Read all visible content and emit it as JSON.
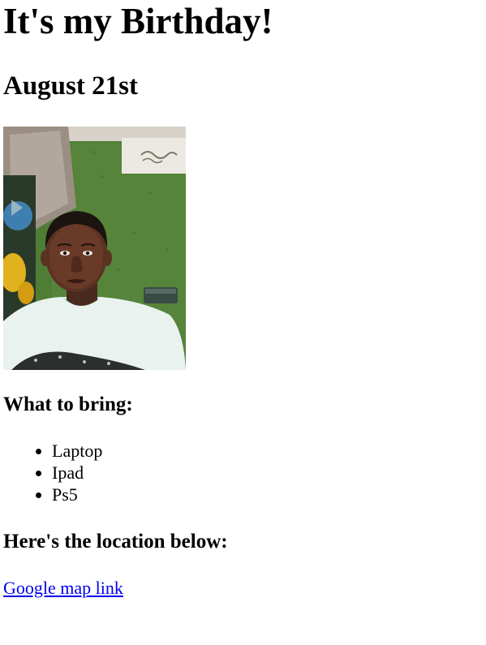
{
  "page": {
    "title": "It's my Birthday!",
    "date": "August 21st",
    "photo": {
      "icon": "person-selfie-photo"
    },
    "bring_heading": "What to bring:",
    "bring_items": [
      "Laptop",
      "Ipad",
      "Ps5"
    ],
    "location_heading": "Here's the location below:",
    "map_link": {
      "label": "Google map link",
      "color": "#0000ee"
    }
  }
}
